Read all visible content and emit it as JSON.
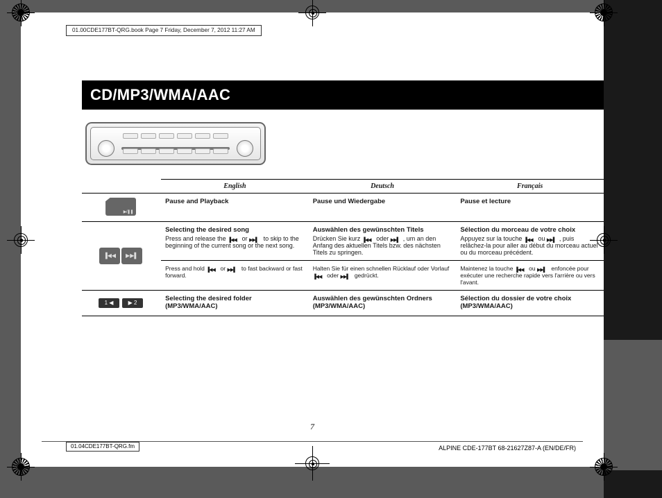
{
  "meta": {
    "header_stamp": "01.00CDE177BT-QRG.book  Page 7  Friday, December 7, 2012  11:27 AM",
    "footer_file": "01.04CDE177BT-QRG.fm",
    "footer_code": "ALPINE CDE-177BT 68-21627Z87-A (EN/DE/FR)",
    "page_number": "7"
  },
  "section_title": "CD/MP3/WMA/AAC",
  "table": {
    "headers": {
      "en": "English",
      "de": "Deutsch",
      "fr": "Français"
    },
    "rows": [
      {
        "icon_desc": "pause-play-button-icon",
        "en": {
          "title": "Pause and Playback"
        },
        "de": {
          "title": "Pause und Wiedergabe"
        },
        "fr": {
          "title": "Pause et lecture"
        }
      },
      {
        "icon_desc": "skip-prev-next-buttons-icon",
        "en": {
          "title": "Selecting the desired song",
          "body_pre": "Press and release the ",
          "body_mid": " or ",
          "body_post": " to skip to the beginning of the current song or the next song."
        },
        "de": {
          "title": "Auswählen des gewünschten Titels",
          "body_pre": "Drücken Sie kurz ",
          "body_mid": " oder ",
          "body_post": ", um an den Anfang des aktuellen Titels bzw. des nächsten Titels zu springen."
        },
        "fr": {
          "title": "Sélection du morceau de votre choix",
          "body_pre": "Appuyez sur la touche ",
          "body_mid": " ou ",
          "body_post": ", puis relâchez-la pour aller au début du morceau actuel ou du morceau précédent."
        }
      },
      {
        "subrow": true,
        "en": {
          "body_pre": "Press and hold ",
          "body_mid": " or ",
          "body_post": " to fast backward or fast forward."
        },
        "de": {
          "body_pre": "Halten Sie für einen schnellen Rücklauf oder Vorlauf ",
          "body_mid": " oder ",
          "body_post": " gedrückt."
        },
        "fr": {
          "body_pre": "Maintenez la touche ",
          "body_mid": " ou ",
          "body_post": " enfoncée pour exécuter une recherche rapide vers l'arrière ou vers l'avant."
        }
      },
      {
        "icon_desc": "folder-1-2-buttons-icon",
        "en": {
          "title": "Selecting the desired folder (MP3/WMA/AAC)"
        },
        "de": {
          "title": "Auswählen des gewünschten Ordners (MP3/WMA/AAC)"
        },
        "fr": {
          "title": "Sélection du dossier de votre choix (MP3/WMA/AAC)"
        }
      }
    ],
    "folder_btn_labels": {
      "a": "1 ◀",
      "b": "▶ 2"
    },
    "skip_btn_labels": {
      "a": "▐◀◀",
      "b": "▶▶▌"
    }
  }
}
